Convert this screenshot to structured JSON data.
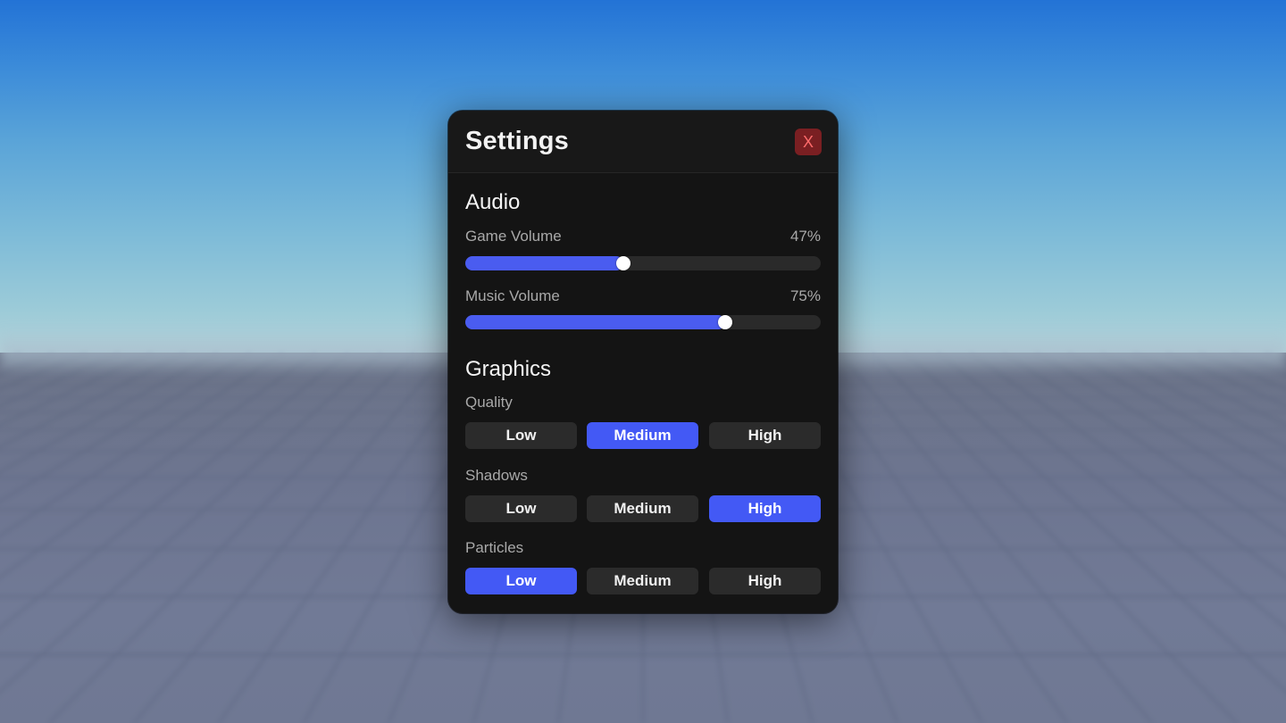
{
  "settings": {
    "title": "Settings",
    "close_label": "X",
    "audio": {
      "title": "Audio",
      "game_volume": {
        "label": "Game Volume",
        "value_text": "47%",
        "level": 0.445
      },
      "music_volume": {
        "label": "Music Volume",
        "value_text": "75%",
        "level": 0.73
      }
    },
    "graphics": {
      "title": "Graphics",
      "quality": {
        "label": "Quality",
        "options": [
          "Low",
          "Medium",
          "High"
        ],
        "selected": "Medium"
      },
      "shadows": {
        "label": "Shadows",
        "options": [
          "Low",
          "Medium",
          "High"
        ],
        "selected": "High"
      },
      "particles": {
        "label": "Particles",
        "options": [
          "Low",
          "Medium",
          "High"
        ],
        "selected": "Low"
      }
    }
  },
  "colors": {
    "accent": "#4359f5",
    "panel_bg": "#141414",
    "close_bg": "#7a1f22",
    "close_text": "#ff6b6b"
  }
}
